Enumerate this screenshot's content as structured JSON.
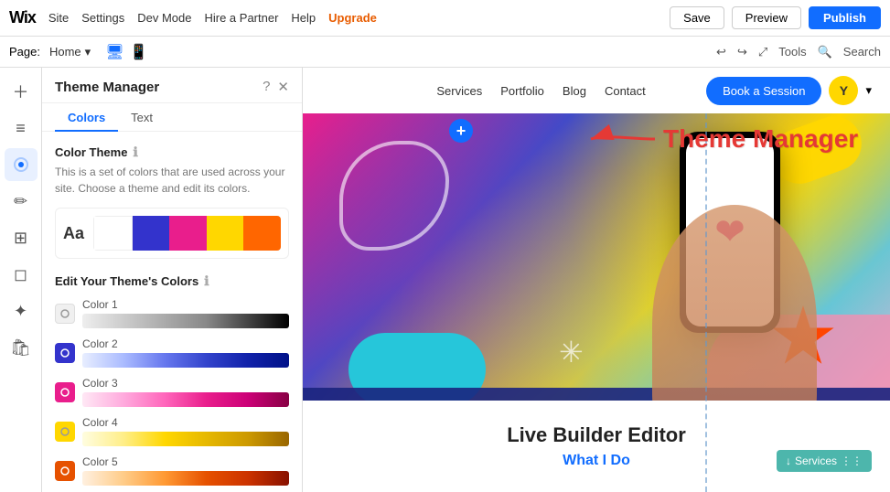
{
  "topbar": {
    "logo": "Wix",
    "nav": [
      {
        "label": "Site",
        "id": "site"
      },
      {
        "label": "Settings",
        "id": "settings"
      },
      {
        "label": "Dev Mode",
        "id": "dev-mode"
      },
      {
        "label": "Hire a Partner",
        "id": "hire"
      },
      {
        "label": "Help",
        "id": "help"
      },
      {
        "label": "Upgrade",
        "id": "upgrade"
      }
    ],
    "save_label": "Save",
    "preview_label": "Preview",
    "publish_label": "Publish"
  },
  "secondbar": {
    "page_label": "Page:",
    "page_name": "Home",
    "undo_symbol": "↩",
    "redo_symbol": "↪",
    "tools_label": "Tools",
    "search_placeholder": "Search"
  },
  "left_tools": [
    {
      "id": "add",
      "icon": "+",
      "label": "Add"
    },
    {
      "id": "pages",
      "icon": "☰",
      "label": "Pages"
    },
    {
      "id": "theme",
      "icon": "◈",
      "label": "Theme",
      "active": true
    },
    {
      "id": "edit",
      "icon": "✏",
      "label": "Edit"
    },
    {
      "id": "apps",
      "icon": "⊞",
      "label": "Apps"
    },
    {
      "id": "media",
      "icon": "🖼",
      "label": "Media"
    },
    {
      "id": "blog",
      "icon": "✦",
      "label": "Blog"
    },
    {
      "id": "store",
      "icon": "🛍",
      "label": "Store"
    }
  ],
  "theme_panel": {
    "title": "Theme Manager",
    "help_symbol": "?",
    "close_symbol": "✕",
    "tabs": [
      {
        "label": "Colors",
        "active": true
      },
      {
        "label": "Text",
        "active": false
      }
    ],
    "color_theme_section": {
      "title": "Color Theme",
      "description": "This is a set of colors that are used across your site. Choose a theme and edit its colors.",
      "info_symbol": "ℹ",
      "preview_aa": "Aa",
      "swatches": [
        {
          "color": "#ffffff"
        },
        {
          "color": "#3333cc"
        },
        {
          "color": "#e91e8c"
        },
        {
          "color": "#ffd700"
        },
        {
          "color": "#ff6600"
        }
      ]
    },
    "edit_section": {
      "title": "Edit Your Theme's Colors",
      "info_symbol": "ℹ",
      "colors": [
        {
          "id": "color1",
          "label": "Color 1",
          "dot_bg": "#f0f0f0",
          "dot_icon": "◎",
          "strip_gradient": "linear-gradient(to right, #eee, #ccc, #aaa, #888, #333, #000)"
        },
        {
          "id": "color2",
          "label": "Color 2",
          "dot_bg": "#3333cc",
          "dot_icon": "◎",
          "strip_gradient": "linear-gradient(to right, #e8eeff, #aabbff, #6677ee, #3344cc, #1122aa, #001188)"
        },
        {
          "id": "color3",
          "label": "Color 3",
          "dot_bg": "#e91e8c",
          "dot_icon": "◎",
          "strip_gradient": "linear-gradient(to right, #ffe8f5, #ffaadd, #ff66bb, #e91e8c, #cc0077, #880044)"
        },
        {
          "id": "color4",
          "label": "Color 4",
          "dot_bg": "#ffd700",
          "dot_icon": "◎",
          "strip_gradient": "linear-gradient(to right, #fffde0, #ffee88, #ffd700, #e6b800, #cc9900, #996600)"
        },
        {
          "id": "color5",
          "label": "Color 5",
          "dot_bg": "#e65100",
          "dot_icon": "◎",
          "strip_gradient": "linear-gradient(to right, #fff0e0, #ffcc88, #ff9933, #e65100, #cc3300, #881100)"
        }
      ]
    }
  },
  "website": {
    "nav_links": [
      "Services",
      "Portfolio",
      "Blog",
      "Contact"
    ],
    "cta_button": "Book a Session",
    "bottom_title": "Live Builder Editor",
    "bottom_subtitle": "What I Do",
    "services_badge": "Services"
  },
  "annotation": {
    "text": "Theme Manager"
  }
}
